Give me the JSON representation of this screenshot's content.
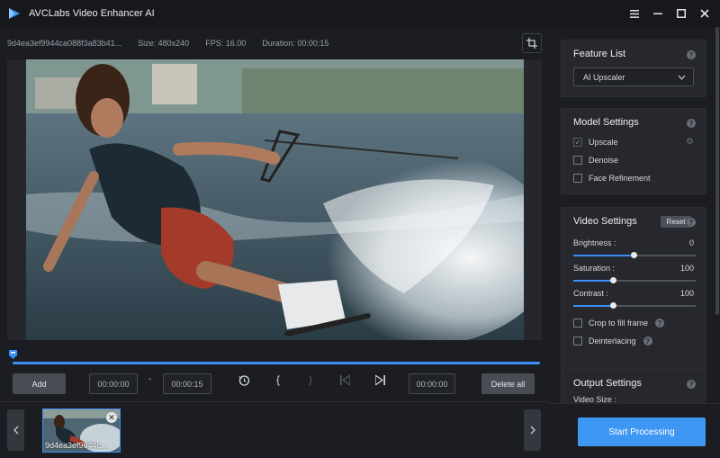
{
  "app": {
    "title": "AVCLabs Video Enhancer AI"
  },
  "window_controls": {
    "menu_icon": "hamburger-icon",
    "minimize_icon": "minimize-icon",
    "maximize_icon": "maximize-icon",
    "close_icon": "close-icon"
  },
  "info_bar": {
    "filename": "9d4ea3ef9944ca088f3a83b41...",
    "size_label": "Size:",
    "size_value": "480x240",
    "fps_label": "FPS:",
    "fps_value": "16.00",
    "duration_label": "Duration:",
    "duration_value": "00:00:15"
  },
  "controls": {
    "add_label": "Add",
    "start_time": "00:00:00",
    "separator": "-",
    "end_time": "00:00:15",
    "current_time": "00:00:00",
    "delete_all_label": "Delete all",
    "bracket_open": "{",
    "bracket_close": "}"
  },
  "thumbnail": {
    "name": "9d4ea3ef9944c..."
  },
  "right_panel": {
    "feature_list": {
      "title": "Feature List",
      "selected": "AI Upscaler"
    },
    "model_settings": {
      "title": "Model Settings",
      "options": [
        {
          "label": "Upscale",
          "checked": true
        },
        {
          "label": "Denoise",
          "checked": false
        },
        {
          "label": "Face Refinement",
          "checked": false
        }
      ]
    },
    "video_settings": {
      "title": "Video Settings",
      "reset_label": "Reset",
      "sliders": [
        {
          "label": "Brightness :",
          "value": "0",
          "fraction": 0.5
        },
        {
          "label": "Saturation :",
          "value": "100",
          "fraction": 0.33
        },
        {
          "label": "Contrast :",
          "value": "100",
          "fraction": 0.33
        }
      ],
      "crop_label": "Crop to fill frame",
      "deinterlace_label": "Deinterlacing"
    },
    "output_settings": {
      "title": "Output Settings",
      "video_size_label": "Video Size :"
    },
    "start_label": "Start Processing"
  },
  "colors": {
    "accent": "#3f97f4",
    "background": "#1b1d22",
    "panel": "#26282e"
  }
}
